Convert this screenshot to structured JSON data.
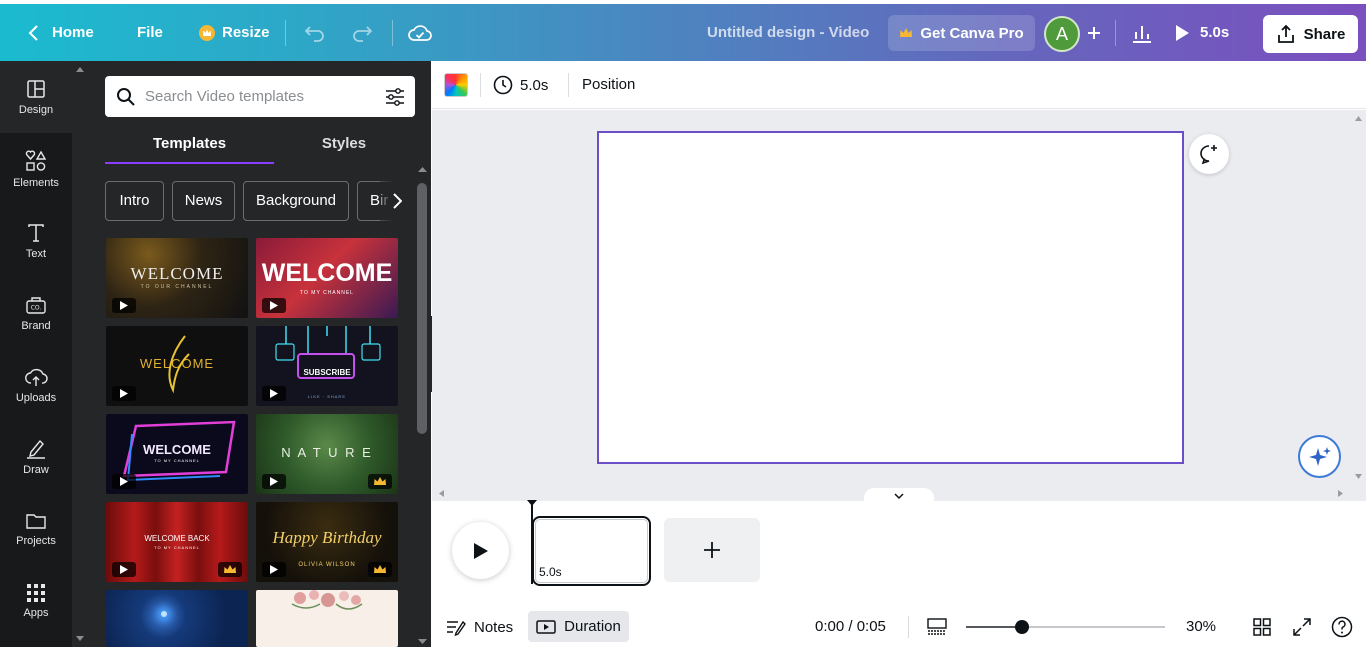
{
  "topbar": {
    "home_label": "Home",
    "file_label": "File",
    "resize_label": "Resize",
    "title": "Untitled design - Video",
    "pro_label": "Get Canva Pro",
    "avatar_initial": "A",
    "play_duration": "5.0s",
    "share_label": "Share"
  },
  "rail": {
    "items": [
      {
        "label": "Design",
        "icon": "layout-icon"
      },
      {
        "label": "Elements",
        "icon": "shapes-icon"
      },
      {
        "label": "Text",
        "icon": "text-icon"
      },
      {
        "label": "Brand",
        "icon": "brand-kit-icon"
      },
      {
        "label": "Uploads",
        "icon": "cloud-upload-icon"
      },
      {
        "label": "Draw",
        "icon": "pen-icon"
      },
      {
        "label": "Projects",
        "icon": "folder-icon"
      },
      {
        "label": "Apps",
        "icon": "grid-icon"
      }
    ]
  },
  "panel": {
    "search_placeholder": "Search Video templates",
    "tabs": [
      {
        "label": "Templates"
      },
      {
        "label": "Styles"
      }
    ],
    "chips": [
      "Intro",
      "News",
      "Background",
      "Bir"
    ],
    "templates": [
      {
        "text": "WELCOME",
        "sub": "TO OUR CHANNEL",
        "premium": false
      },
      {
        "text": "WELCOME",
        "sub": "TO MY CHANNEL",
        "premium": false
      },
      {
        "text": "WELCOME",
        "sub": "",
        "premium": false
      },
      {
        "text": "SUBSCRIBE",
        "sub": "LIKE · SHARE",
        "premium": false
      },
      {
        "text": "WELCOME",
        "sub": "TO MY CHANNEL",
        "premium": false
      },
      {
        "text": "N A T U R E",
        "sub": "",
        "premium": true
      },
      {
        "text": "WELCOME BACK",
        "sub": "TO MY CHANNEL",
        "premium": true
      },
      {
        "text": "Happy Birthday",
        "sub": "OLIVIA WILSON",
        "premium": true
      },
      {
        "text": "",
        "sub": "",
        "premium": false
      },
      {
        "text": "",
        "sub": "",
        "premium": false
      }
    ]
  },
  "editor": {
    "duration": "5.0s",
    "position_label": "Position"
  },
  "timeline": {
    "clip_duration": "5.0s"
  },
  "footer": {
    "notes_label": "Notes",
    "duration_label": "Duration",
    "time": "0:00 / 0:05",
    "zoom": "30%",
    "zoom_level": 0.28
  },
  "colors": {
    "accent": "#8b3dff",
    "page_border": "#6a4fc8",
    "topbar_start": "#1bbbcf",
    "topbar_end": "#7b4fbe"
  }
}
